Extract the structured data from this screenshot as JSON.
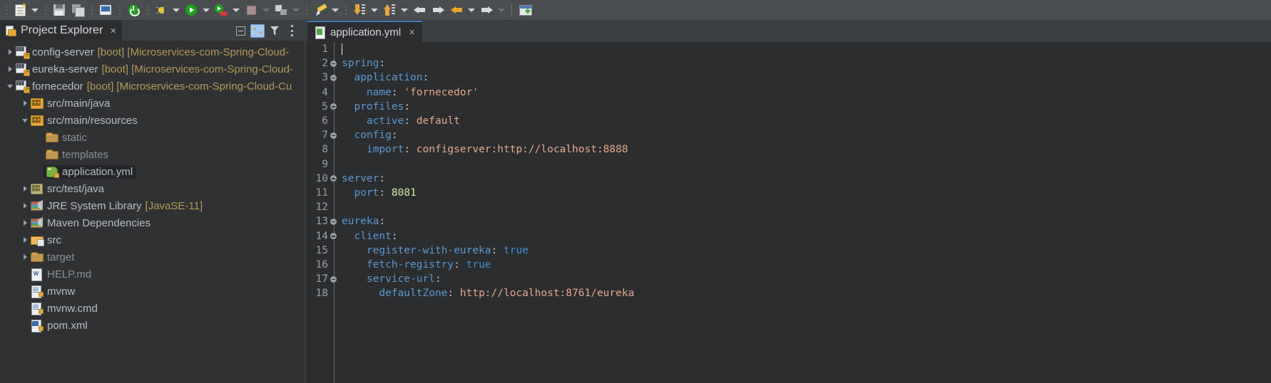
{
  "toolbar": {
    "items": [
      {
        "name": "new-file-button",
        "icon": "new-file-icon",
        "has_dropdown": true
      },
      {
        "name": "save-button",
        "icon": "save-icon",
        "has_dropdown": false
      },
      {
        "name": "save-all-button",
        "icon": "save-all-icon",
        "has_dropdown": false
      },
      {
        "name": "print-button",
        "icon": "print-icon",
        "has_dropdown": false
      },
      {
        "name": "terminate-button",
        "icon": "power-green-icon",
        "has_dropdown": false
      },
      {
        "name": "debug-button",
        "icon": "debug-bug-icon",
        "has_dropdown": true
      },
      {
        "name": "run-button",
        "icon": "run-green-play-icon",
        "has_dropdown": true
      },
      {
        "name": "run-external-tools-button",
        "icon": "run-external-icon",
        "has_dropdown": true
      },
      {
        "name": "stop-button",
        "icon": "stop-square-icon",
        "has_dropdown": true
      },
      {
        "name": "new-window-button",
        "icon": "external-window-icon",
        "has_dropdown": true
      },
      {
        "name": "edit-button",
        "icon": "pencil-icon",
        "has_dropdown": true
      },
      {
        "name": "next-annotation-button",
        "icon": "step-down-icon",
        "has_dropdown": true
      },
      {
        "name": "previous-annotation-button",
        "icon": "step-up-icon",
        "has_dropdown": true
      },
      {
        "name": "back-button",
        "icon": "arrow-left-white-icon",
        "has_dropdown": false
      },
      {
        "name": "forward-button",
        "icon": "arrow-right-white-icon",
        "has_dropdown": false
      },
      {
        "name": "back-history-button",
        "icon": "arrow-left-gold-icon",
        "has_dropdown": true
      },
      {
        "name": "forward-history-button",
        "icon": "arrow-right-white-icon",
        "has_dropdown": true
      },
      {
        "name": "open-editor-button",
        "icon": "editor-window-icon",
        "has_dropdown": false
      }
    ]
  },
  "explorer": {
    "title": "Project Explorer",
    "close_label": "×",
    "tools": [
      {
        "name": "collapse-all-button",
        "icon": "collapse-all-icon"
      },
      {
        "name": "link-with-editor-button",
        "icon": "link-editor-icon",
        "active": true
      },
      {
        "name": "view-menu-filter-button",
        "icon": "filter-icon"
      },
      {
        "name": "view-menu-button",
        "icon": "kebab-menu-icon"
      }
    ],
    "tree": [
      {
        "label": "config-server",
        "meta": "[boot] [Microservices-com-Spring-Cloud-",
        "icon": "spring-boot-project-icon",
        "twisty": "closed",
        "indent": 0,
        "selected": false,
        "dim": false
      },
      {
        "label": "eureka-server",
        "meta": "[boot] [Microservices-com-Spring-Cloud-",
        "icon": "spring-boot-project-icon",
        "twisty": "closed",
        "indent": 0,
        "selected": false,
        "dim": false
      },
      {
        "label": "fornecedor",
        "meta": "[boot] [Microservices-com-Spring-Cloud-Cu",
        "icon": "spring-boot-project-icon",
        "twisty": "open",
        "indent": 0,
        "selected": false,
        "dim": false
      },
      {
        "label": "src/main/java",
        "meta": "",
        "icon": "source-package-icon",
        "twisty": "closed",
        "indent": 1,
        "selected": false,
        "dim": false
      },
      {
        "label": "src/main/resources",
        "meta": "",
        "icon": "source-package-icon",
        "twisty": "open",
        "indent": 1,
        "selected": false,
        "dim": false
      },
      {
        "label": "static",
        "meta": "",
        "icon": "folder-icon",
        "twisty": "none",
        "indent": 2,
        "selected": false,
        "dim": true
      },
      {
        "label": "templates",
        "meta": "",
        "icon": "folder-icon",
        "twisty": "none",
        "indent": 2,
        "selected": false,
        "dim": true
      },
      {
        "label": "application.yml",
        "meta": "",
        "icon": "yaml-file-icon",
        "twisty": "none",
        "indent": 2,
        "selected": true,
        "dim": false
      },
      {
        "label": "src/test/java",
        "meta": "",
        "icon": "test-package-icon",
        "twisty": "closed",
        "indent": 1,
        "selected": false,
        "dim": false
      },
      {
        "label": "JRE System Library",
        "meta": "[JavaSE-11]",
        "icon": "library-icon",
        "twisty": "closed",
        "indent": 1,
        "selected": false,
        "dim": false
      },
      {
        "label": "Maven Dependencies",
        "meta": "",
        "icon": "library-icon",
        "twisty": "closed",
        "indent": 1,
        "selected": false,
        "dim": false
      },
      {
        "label": "src",
        "meta": "",
        "icon": "source-folder-icon",
        "twisty": "closed",
        "indent": 1,
        "selected": false,
        "dim": false
      },
      {
        "label": "target",
        "meta": "",
        "icon": "folder-icon",
        "twisty": "closed",
        "indent": 1,
        "selected": false,
        "dim": true
      },
      {
        "label": "HELP.md",
        "meta": "",
        "icon": "markdown-file-icon",
        "twisty": "none",
        "indent": 1,
        "selected": false,
        "dim": true
      },
      {
        "label": "mvnw",
        "meta": "",
        "icon": "text-file-icon",
        "twisty": "none",
        "indent": 1,
        "selected": false,
        "dim": false
      },
      {
        "label": "mvnw.cmd",
        "meta": "",
        "icon": "text-file-icon",
        "twisty": "none",
        "indent": 1,
        "selected": false,
        "dim": false
      },
      {
        "label": "pom.xml",
        "meta": "",
        "icon": "pom-file-icon",
        "twisty": "none",
        "indent": 1,
        "selected": false,
        "dim": false
      }
    ]
  },
  "editor": {
    "window_controls": [
      {
        "name": "minimize-editor-button",
        "icon": "minimize-icon"
      },
      {
        "name": "maximize-editor-button",
        "icon": "maximize-icon"
      }
    ],
    "tabs": [
      {
        "label": "application.yml",
        "icon": "yaml-file-icon",
        "active": true,
        "close_label": "×"
      }
    ],
    "lines": [
      {
        "no": "1",
        "fold": false,
        "tokens": [
          {
            "t": "",
            "c": "p"
          }
        ],
        "caret": true
      },
      {
        "no": "2",
        "fold": true,
        "tokens": [
          {
            "t": "spring",
            "c": "k"
          },
          {
            "t": ":",
            "c": "p"
          }
        ]
      },
      {
        "no": "3",
        "fold": true,
        "tokens": [
          {
            "t": "  application",
            "c": "k"
          },
          {
            "t": ":",
            "c": "p"
          }
        ]
      },
      {
        "no": "4",
        "fold": false,
        "tokens": [
          {
            "t": "    name",
            "c": "k"
          },
          {
            "t": ": ",
            "c": "p"
          },
          {
            "t": "'fornecedor'",
            "c": "s"
          }
        ]
      },
      {
        "no": "5",
        "fold": true,
        "tokens": [
          {
            "t": "  profiles",
            "c": "k"
          },
          {
            "t": ":",
            "c": "p"
          }
        ]
      },
      {
        "no": "6",
        "fold": false,
        "tokens": [
          {
            "t": "    active",
            "c": "k"
          },
          {
            "t": ": ",
            "c": "p"
          },
          {
            "t": "default",
            "c": "s"
          }
        ]
      },
      {
        "no": "7",
        "fold": true,
        "tokens": [
          {
            "t": "  config",
            "c": "k"
          },
          {
            "t": ":",
            "c": "p"
          }
        ]
      },
      {
        "no": "8",
        "fold": false,
        "tokens": [
          {
            "t": "    import",
            "c": "k"
          },
          {
            "t": ": ",
            "c": "p"
          },
          {
            "t": "configserver:http://localhost:8888",
            "c": "s"
          }
        ]
      },
      {
        "no": "9",
        "fold": false,
        "tokens": [
          {
            "t": "",
            "c": "p"
          }
        ]
      },
      {
        "no": "10",
        "fold": true,
        "tokens": [
          {
            "t": "server",
            "c": "k"
          },
          {
            "t": ":",
            "c": "p"
          }
        ]
      },
      {
        "no": "11",
        "fold": false,
        "tokens": [
          {
            "t": "  port",
            "c": "k"
          },
          {
            "t": ": ",
            "c": "p"
          },
          {
            "t": "8081",
            "c": "n"
          }
        ]
      },
      {
        "no": "12",
        "fold": false,
        "tokens": [
          {
            "t": "",
            "c": "p"
          }
        ]
      },
      {
        "no": "13",
        "fold": true,
        "tokens": [
          {
            "t": "eureka",
            "c": "k"
          },
          {
            "t": ":",
            "c": "p"
          }
        ]
      },
      {
        "no": "14",
        "fold": true,
        "tokens": [
          {
            "t": "  client",
            "c": "k"
          },
          {
            "t": ":",
            "c": "p"
          }
        ]
      },
      {
        "no": "15",
        "fold": false,
        "tokens": [
          {
            "t": "    register-with-eureka",
            "c": "k"
          },
          {
            "t": ": ",
            "c": "p"
          },
          {
            "t": "true",
            "c": "b"
          }
        ]
      },
      {
        "no": "16",
        "fold": false,
        "tokens": [
          {
            "t": "    fetch-registry",
            "c": "k"
          },
          {
            "t": ": ",
            "c": "p"
          },
          {
            "t": "true",
            "c": "b"
          }
        ]
      },
      {
        "no": "17",
        "fold": true,
        "tokens": [
          {
            "t": "    service-url",
            "c": "k"
          },
          {
            "t": ":",
            "c": "p"
          }
        ]
      },
      {
        "no": "18",
        "fold": false,
        "tokens": [
          {
            "t": "      defaultZone",
            "c": "k"
          },
          {
            "t": ": ",
            "c": "p"
          },
          {
            "t": "http://localhost:8761/eureka",
            "c": "s"
          }
        ]
      }
    ]
  },
  "colors": {
    "toolbar_bg": "#4a4d50",
    "panel_bg": "#2f3133",
    "editor_bg": "#2b2d2f",
    "tab_active_border": "#3b80c4",
    "key_blue": "#5a9ad4",
    "string_orange": "#e8a88a",
    "number_green": "#d5e8a3",
    "meta_gold": "#b59a55"
  }
}
